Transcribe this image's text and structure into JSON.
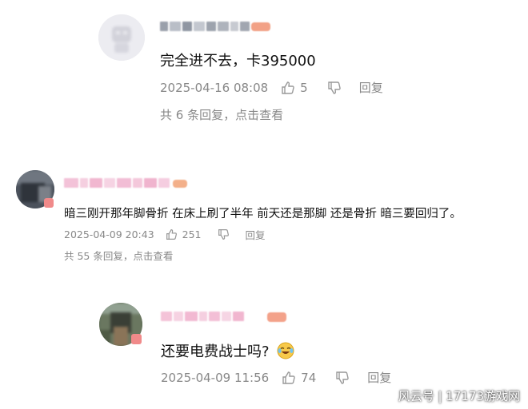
{
  "comments": [
    {
      "text": "完全进不去，卡395000",
      "date": "2025-04-16 08:08",
      "likes": "5",
      "reply_label": "回复",
      "replies_summary": "共 6 条回复，点击查看"
    },
    {
      "text": "暗三刚开那年脚骨折 在床上刷了半年 前天还是那脚 还是骨折 暗三要回归了。",
      "date": "2025-04-09 20:43",
      "likes": "251",
      "reply_label": "回复",
      "replies_summary": "共 55 条回复，点击查看"
    },
    {
      "text": "还要电费战士吗?",
      "date": "2025-04-09 11:56",
      "likes": "74",
      "reply_label": "回复"
    }
  ],
  "watermark": "风云号 | 17173游戏网",
  "icons": {
    "like": "thumbs-up-icon",
    "dislike": "thumbs-down-icon",
    "emoji": "crying-laughing-emoji"
  },
  "colors": {
    "meta_text": "#888888",
    "vip_badge": "#f08a8a",
    "username_pink": "#f2b3cf"
  }
}
